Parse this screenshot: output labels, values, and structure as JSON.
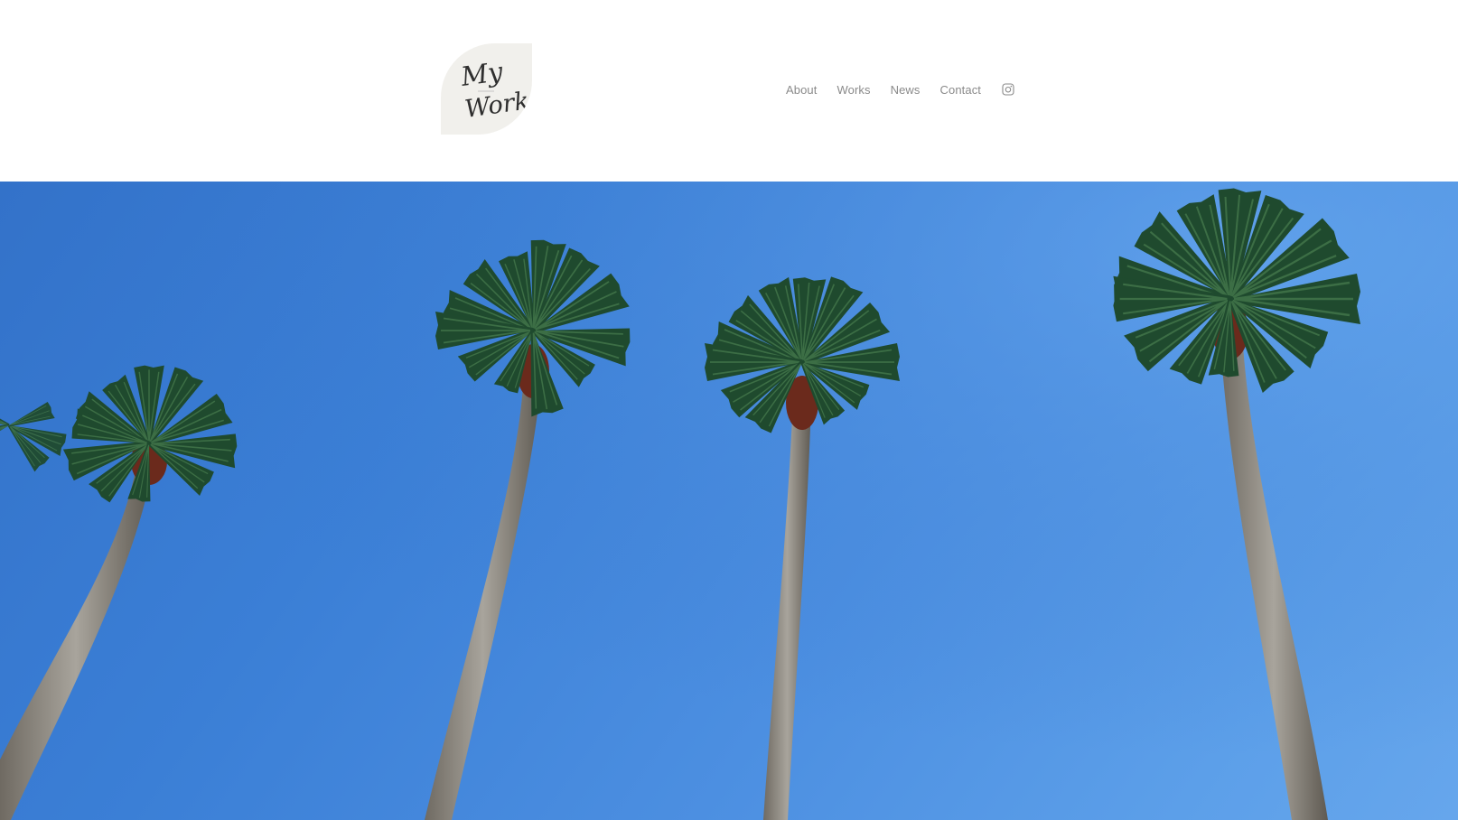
{
  "header": {
    "logo": {
      "line1": "My",
      "line2": "Work",
      "background_color": "#f1f0ec"
    },
    "nav": {
      "items": [
        {
          "label": "About"
        },
        {
          "label": "Works"
        },
        {
          "label": "News"
        },
        {
          "label": "Contact"
        }
      ],
      "social_icon": "instagram-icon"
    }
  },
  "hero": {
    "content": "photo: four palm trees against a clear blue sky",
    "sky_color": "#3b7fd6"
  },
  "colors": {
    "nav_text": "#8a8a8a",
    "background": "#ffffff"
  }
}
